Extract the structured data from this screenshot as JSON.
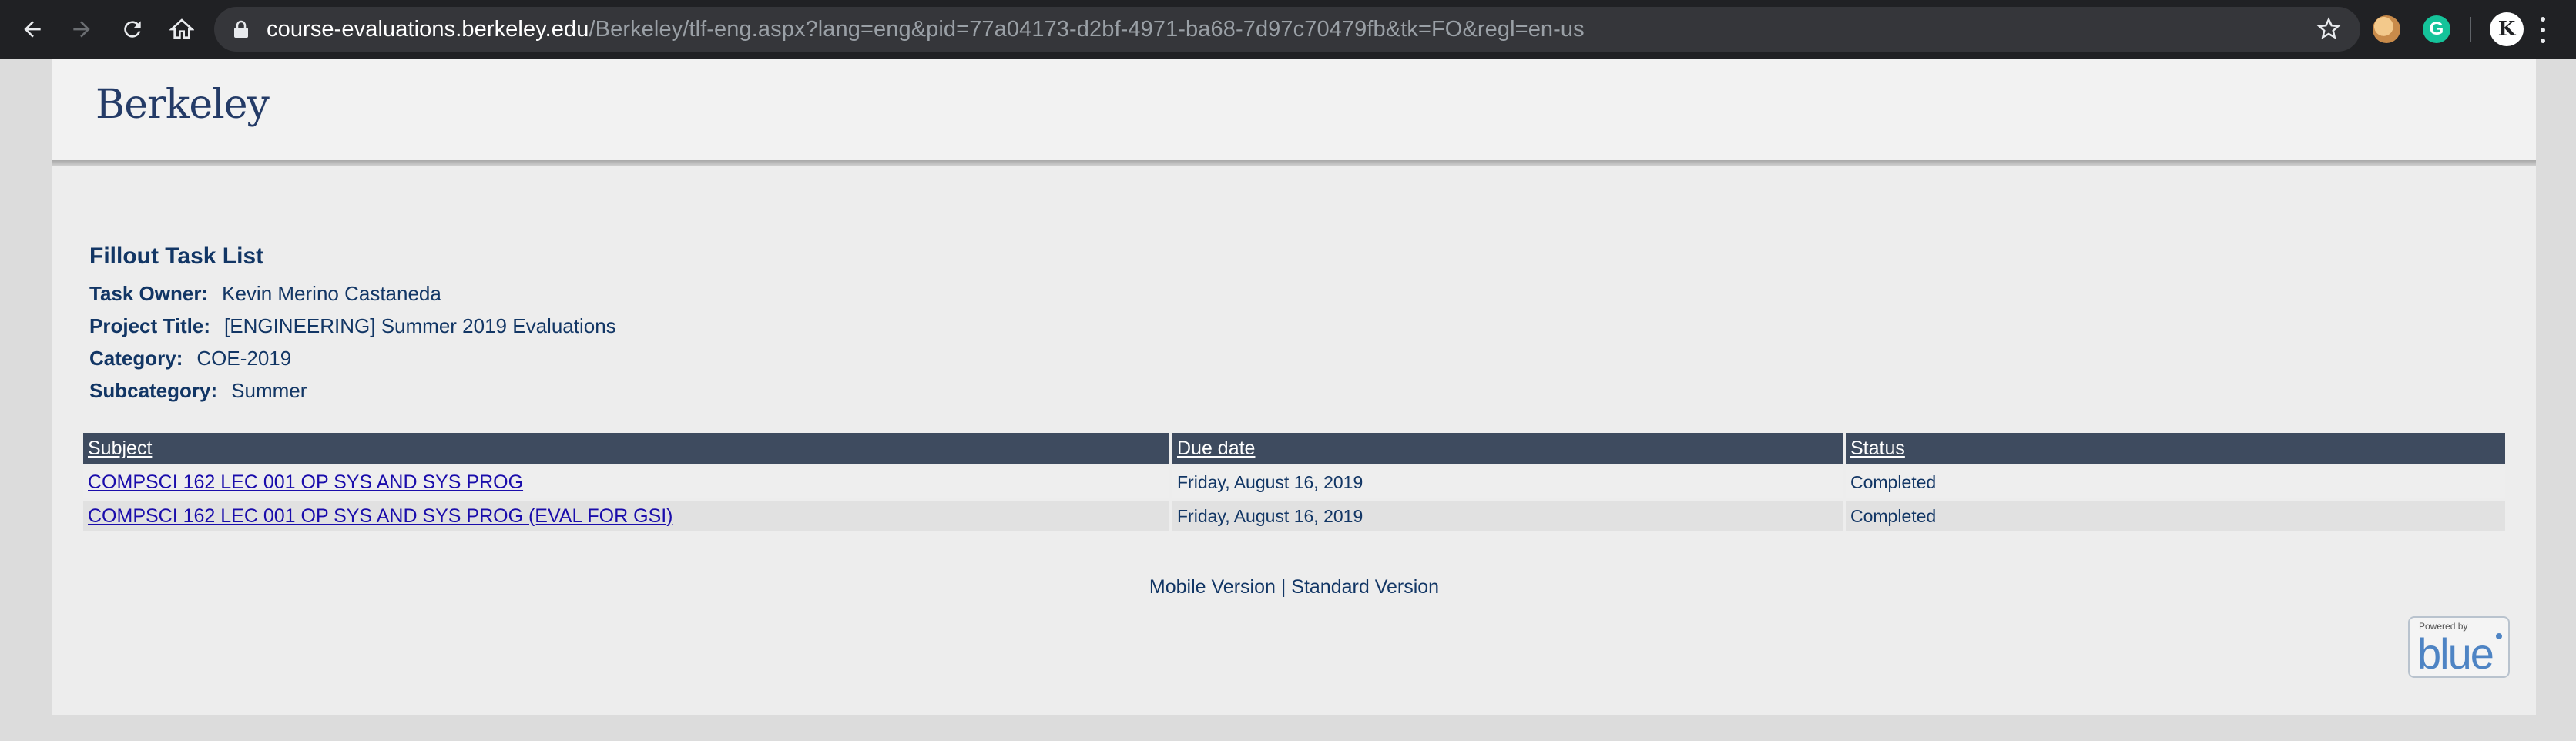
{
  "browser": {
    "url_host": "course-evaluations.berkeley.edu",
    "url_rest": "/Berkeley/tlf-eng.aspx?lang=eng&pid=77a04173-d2bf-4971-ba68-7d97c70479fb&tk=FO&regl=en-us",
    "extension_grammarly": "G",
    "profile_initial": "K"
  },
  "header": {
    "logo_text": "Berkeley"
  },
  "task_info": {
    "title": "Fillout Task List",
    "owner_label": "Task Owner:",
    "owner_value": "Kevin Merino Castaneda",
    "project_label": "Project Title:",
    "project_value": "[ENGINEERING] Summer 2019 Evaluations",
    "category_label": "Category:",
    "category_value": "COE-2019",
    "subcategory_label": "Subcategory:",
    "subcategory_value": "Summer"
  },
  "table": {
    "headers": [
      "Subject",
      "Due date",
      "Status"
    ],
    "rows": [
      {
        "subject": "COMPSCI 162 LEC 001 OP SYS AND SYS PROG",
        "due": "Friday, August 16, 2019",
        "status": "Completed"
      },
      {
        "subject": "COMPSCI 162 LEC 001 OP SYS AND SYS PROG (EVAL FOR GSI)",
        "due": "Friday, August 16, 2019",
        "status": "Completed"
      }
    ]
  },
  "footer": {
    "mobile": "Mobile Version",
    "separator": " | ",
    "standard": "Standard Version"
  },
  "powered_by": {
    "small": "Powered by",
    "brand": "blue"
  },
  "colors": {
    "chrome_bg": "#202124",
    "header_text": "#123665",
    "table_header_bg": "#3e4b5f",
    "link": "#1a0dab"
  }
}
